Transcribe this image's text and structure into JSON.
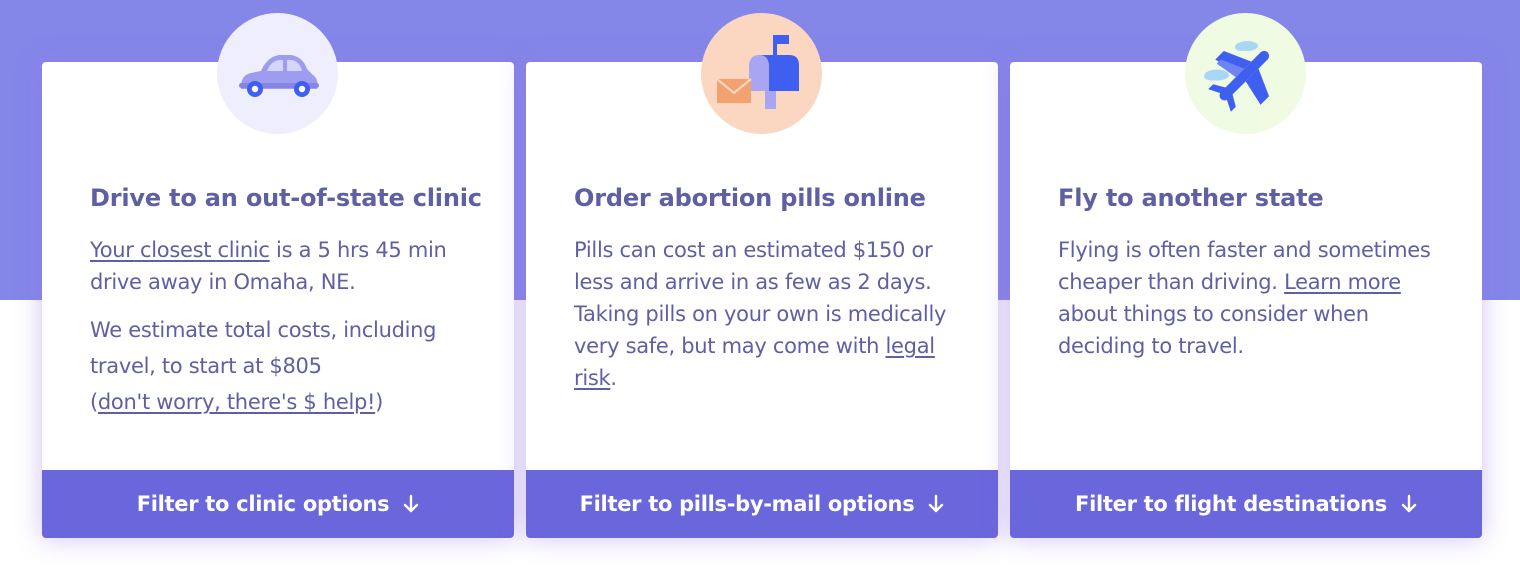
{
  "cards": [
    {
      "icon": "car-icon",
      "title": "Drive to an out-of-state clinic",
      "body_link": "Your closest clinic",
      "body_text": " is a 5 hrs 45 min drive away in Omaha, NE.",
      "cost_text": "We estimate total costs, including travel, to start at $805",
      "help_open": "(",
      "help_link": "don't worry, there's $ help!",
      "help_close": ")",
      "button": "Filter to clinic options"
    },
    {
      "icon": "mailbox-icon",
      "title": "Order abortion pills online",
      "body_text": "Pills can cost an estimated $150 or less and arrive in as few as 2 days. Taking pills on your own is medically very safe, but may come with ",
      "body_link": "legal risk",
      "body_end": ".",
      "button": "Filter to pills-by-mail options"
    },
    {
      "icon": "airplane-icon",
      "title": "Fly to another state",
      "body_text": "Flying is often faster and sometimes cheaper than driving. ",
      "body_link": "Learn more",
      "body_end": " about things to consider when deciding to travel.",
      "button": "Filter to flight destinations"
    }
  ],
  "colors": {
    "band": "#8486e8",
    "button": "#6a66dc",
    "text": "#5f5fa3",
    "icon_blue": "#3f5ff0"
  }
}
